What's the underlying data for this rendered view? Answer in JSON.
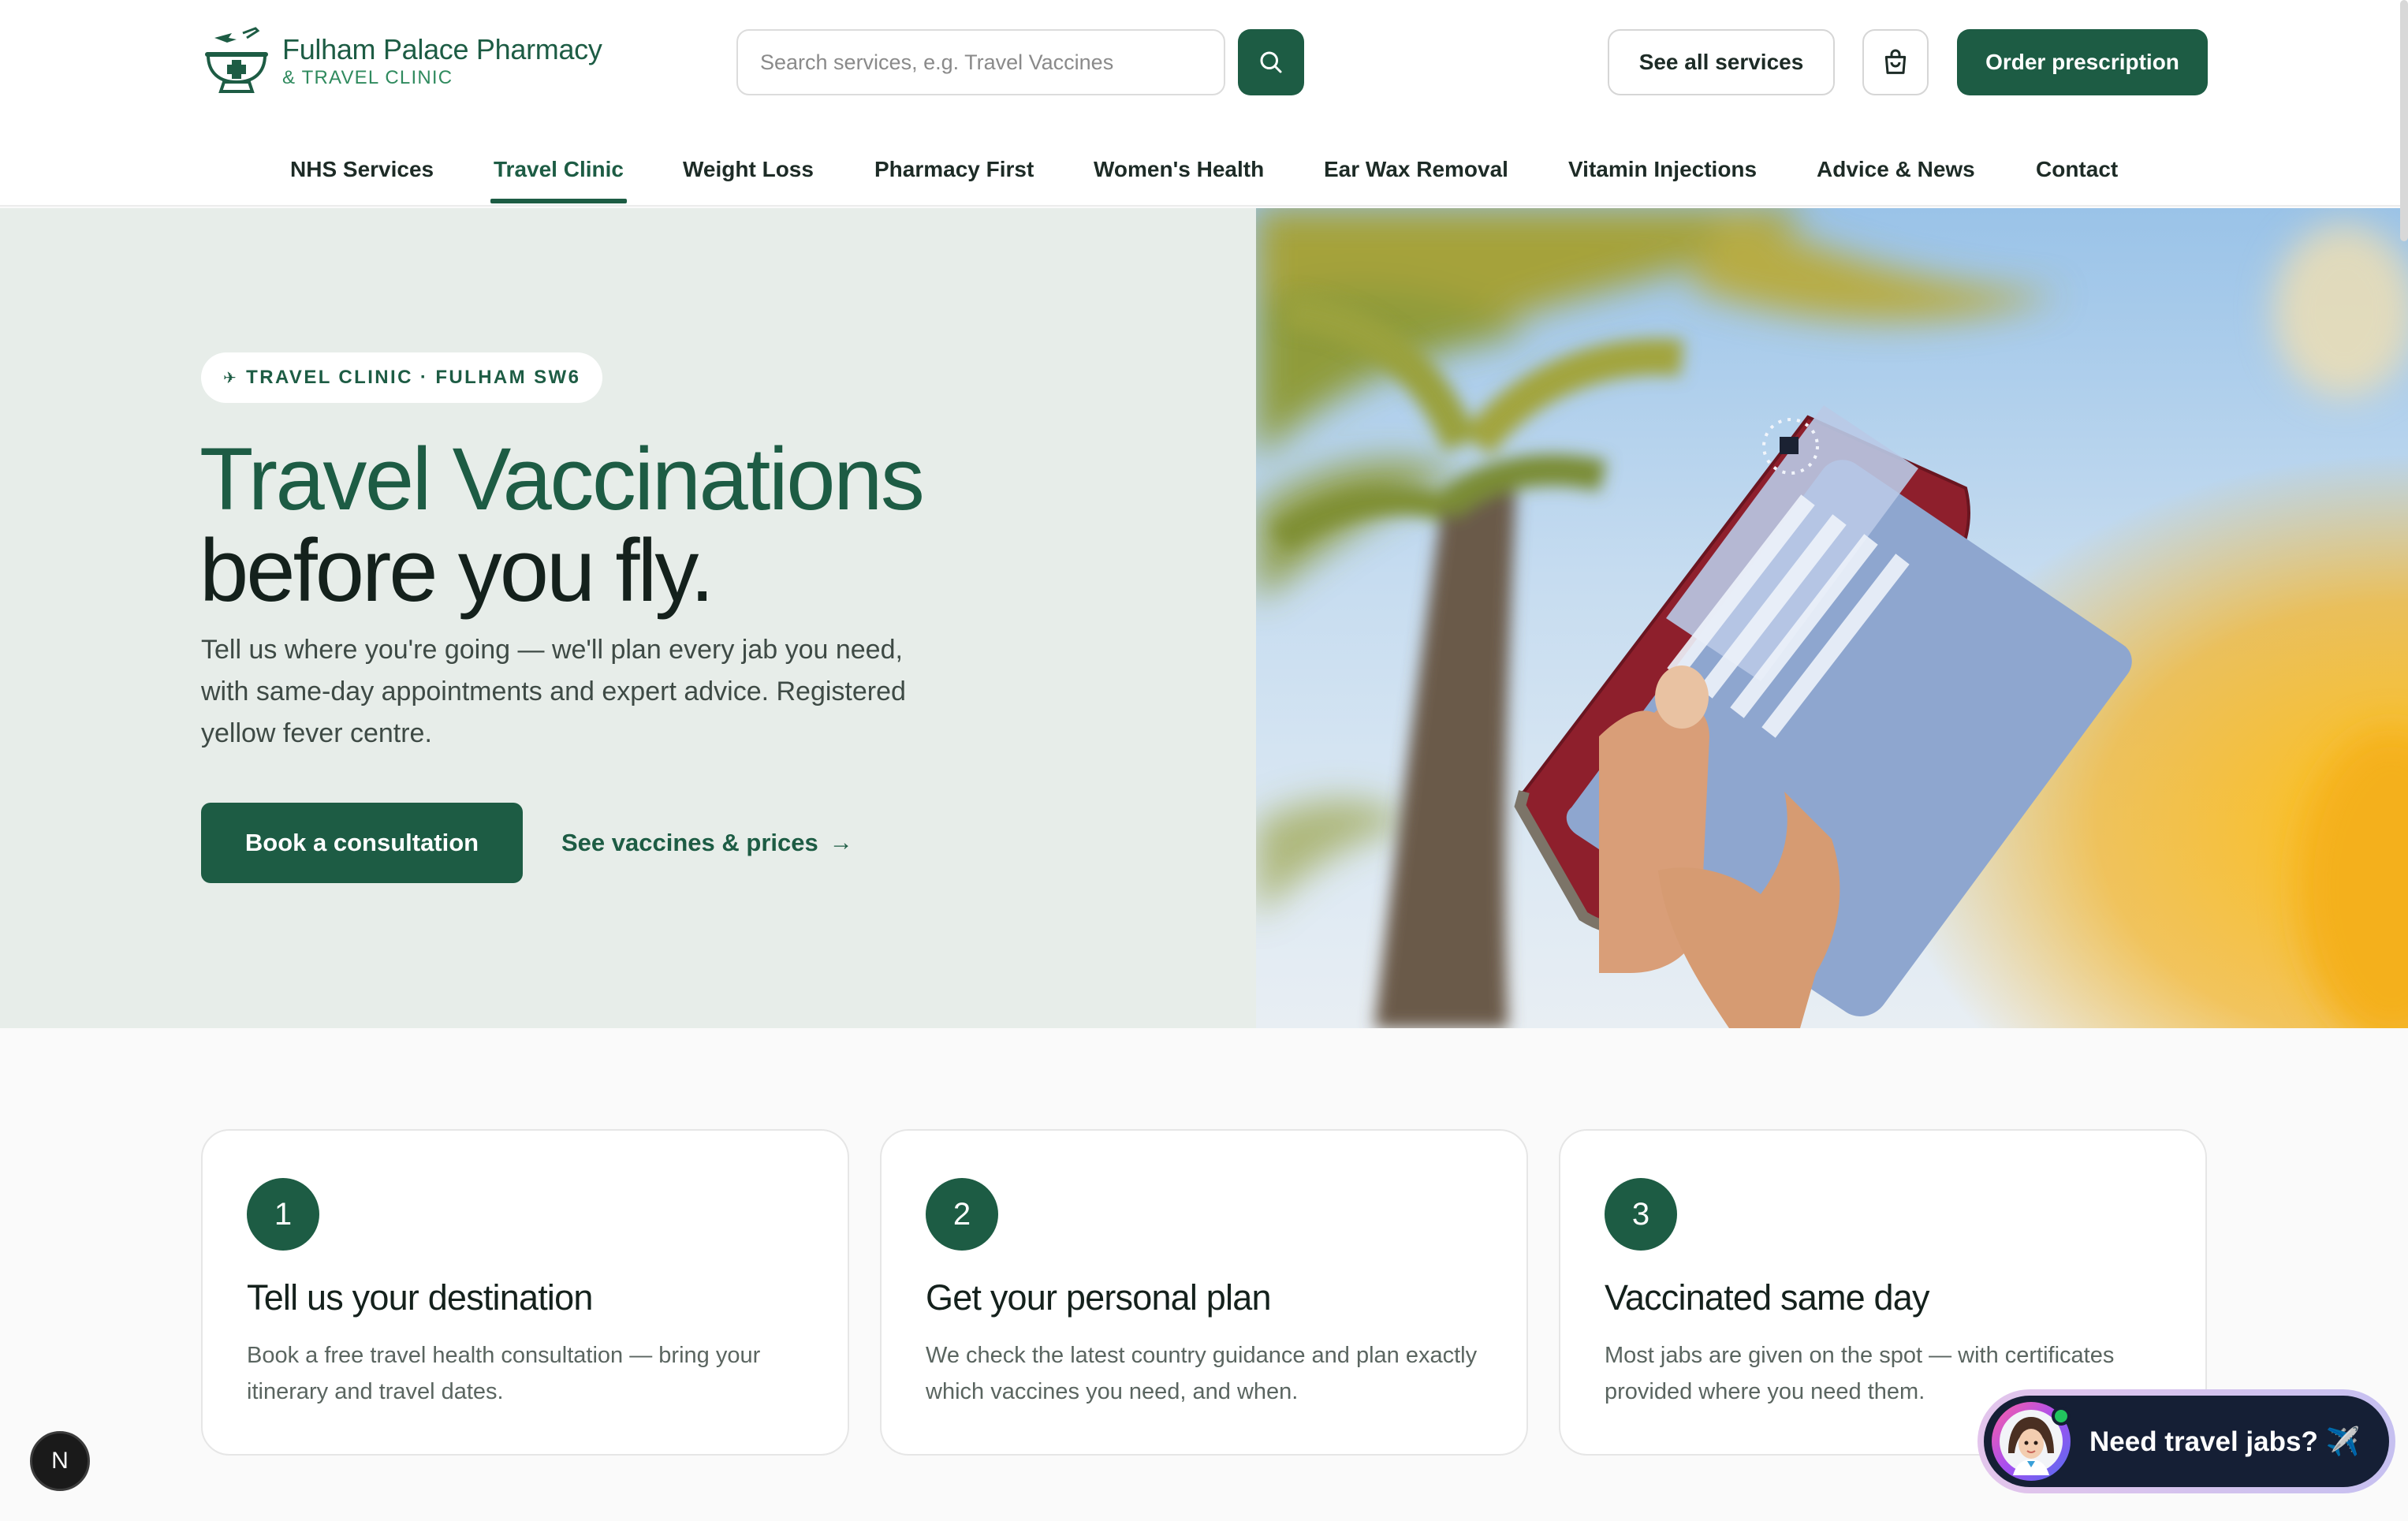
{
  "brand": {
    "title": "Fulham Palace Pharmacy",
    "subtitle": "& TRAVEL CLINIC"
  },
  "search": {
    "placeholder": "Search services, e.g. Travel Vaccines"
  },
  "header_actions": {
    "see_all": "See all services",
    "order": "Order prescription"
  },
  "nav": {
    "items": [
      {
        "label": "NHS Services"
      },
      {
        "label": "Travel Clinic",
        "active": true
      },
      {
        "label": "Weight Loss"
      },
      {
        "label": "Pharmacy First"
      },
      {
        "label": "Women's Health"
      },
      {
        "label": "Ear Wax Removal"
      },
      {
        "label": "Vitamin Injections"
      },
      {
        "label": "Advice & News"
      },
      {
        "label": "Contact"
      }
    ]
  },
  "hero": {
    "badge": "TRAVEL CLINIC · FULHAM SW6",
    "badge_icon": "✈",
    "title_line1": "Travel Vaccinations",
    "title_line2": "before you fly.",
    "description": "Tell us where you're going — we'll plan every jab you need, with same-day appointments and expert advice. Registered yellow fever centre.",
    "primary_cta": "Book a consultation",
    "secondary_cta": "See vaccines & prices",
    "secondary_arrow": "→"
  },
  "steps": [
    {
      "number": "1",
      "title": "Tell us your destination",
      "text": "Book a free travel health consultation — bring your itinerary and travel dates."
    },
    {
      "number": "2",
      "title": "Get your personal plan",
      "text": "We check the latest country guidance and plan exactly which vaccines you need, and when."
    },
    {
      "number": "3",
      "title": "Vaccinated same day",
      "text": "Most jabs are given on the spot — with certificates provided where you need them."
    }
  ],
  "chat": {
    "label": "Need travel jabs? ✈️"
  },
  "dev_badge": "N",
  "colors": {
    "brand": "#1d5c44",
    "hero_bg": "#e7ede9",
    "page_bg": "#fafafa"
  }
}
